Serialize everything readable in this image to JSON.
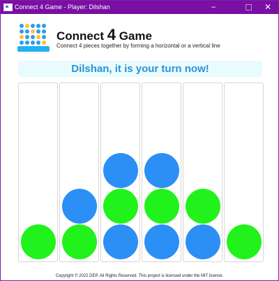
{
  "window": {
    "title": "Connect 4 Game - Player: Dilshan",
    "minimize_glyph": "–",
    "close_glyph": "✕"
  },
  "header": {
    "title_prefix": "Connect ",
    "title_number": "4",
    "title_suffix": " Game",
    "subtitle": "Connect 4 pieces together by forming a horizontal or a vertical line"
  },
  "status": {
    "message": "Dilshan, it is your turn now!"
  },
  "colors": {
    "titlebar": "#7a0fa3",
    "player_green": "#22f21b",
    "player_blue": "#2b8ff5",
    "banner_text": "#2a92da",
    "banner_bg": "#e9fcfd"
  },
  "board": {
    "column_count": 6,
    "columns": [
      {
        "discs_bottom_to_top": [
          "green"
        ]
      },
      {
        "discs_bottom_to_top": [
          "green",
          "blue"
        ]
      },
      {
        "discs_bottom_to_top": [
          "blue",
          "green",
          "blue"
        ]
      },
      {
        "discs_bottom_to_top": [
          "blue",
          "green",
          "blue"
        ]
      },
      {
        "discs_bottom_to_top": [
          "blue",
          "green"
        ]
      },
      {
        "discs_bottom_to_top": [
          "green"
        ]
      }
    ]
  },
  "footer": {
    "text": "Copyright © 2022 DEP. All Rights Reserved. This project is licensed under the MIT license."
  }
}
